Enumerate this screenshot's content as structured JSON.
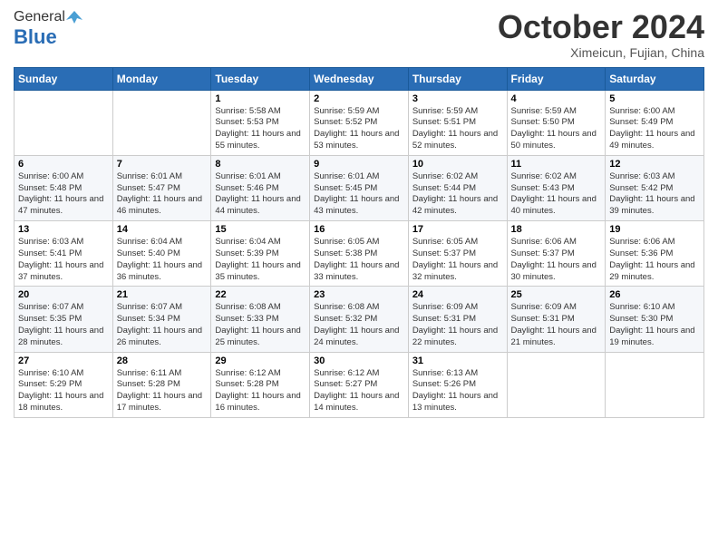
{
  "logo": {
    "general": "General",
    "blue": "Blue"
  },
  "header": {
    "month": "October 2024",
    "location": "Ximeicun, Fujian, China"
  },
  "days_of_week": [
    "Sunday",
    "Monday",
    "Tuesday",
    "Wednesday",
    "Thursday",
    "Friday",
    "Saturday"
  ],
  "weeks": [
    [
      {
        "day": "",
        "sunrise": "",
        "sunset": "",
        "daylight": ""
      },
      {
        "day": "",
        "sunrise": "",
        "sunset": "",
        "daylight": ""
      },
      {
        "day": "1",
        "sunrise": "Sunrise: 5:58 AM",
        "sunset": "Sunset: 5:53 PM",
        "daylight": "Daylight: 11 hours and 55 minutes."
      },
      {
        "day": "2",
        "sunrise": "Sunrise: 5:59 AM",
        "sunset": "Sunset: 5:52 PM",
        "daylight": "Daylight: 11 hours and 53 minutes."
      },
      {
        "day": "3",
        "sunrise": "Sunrise: 5:59 AM",
        "sunset": "Sunset: 5:51 PM",
        "daylight": "Daylight: 11 hours and 52 minutes."
      },
      {
        "day": "4",
        "sunrise": "Sunrise: 5:59 AM",
        "sunset": "Sunset: 5:50 PM",
        "daylight": "Daylight: 11 hours and 50 minutes."
      },
      {
        "day": "5",
        "sunrise": "Sunrise: 6:00 AM",
        "sunset": "Sunset: 5:49 PM",
        "daylight": "Daylight: 11 hours and 49 minutes."
      }
    ],
    [
      {
        "day": "6",
        "sunrise": "Sunrise: 6:00 AM",
        "sunset": "Sunset: 5:48 PM",
        "daylight": "Daylight: 11 hours and 47 minutes."
      },
      {
        "day": "7",
        "sunrise": "Sunrise: 6:01 AM",
        "sunset": "Sunset: 5:47 PM",
        "daylight": "Daylight: 11 hours and 46 minutes."
      },
      {
        "day": "8",
        "sunrise": "Sunrise: 6:01 AM",
        "sunset": "Sunset: 5:46 PM",
        "daylight": "Daylight: 11 hours and 44 minutes."
      },
      {
        "day": "9",
        "sunrise": "Sunrise: 6:01 AM",
        "sunset": "Sunset: 5:45 PM",
        "daylight": "Daylight: 11 hours and 43 minutes."
      },
      {
        "day": "10",
        "sunrise": "Sunrise: 6:02 AM",
        "sunset": "Sunset: 5:44 PM",
        "daylight": "Daylight: 11 hours and 42 minutes."
      },
      {
        "day": "11",
        "sunrise": "Sunrise: 6:02 AM",
        "sunset": "Sunset: 5:43 PM",
        "daylight": "Daylight: 11 hours and 40 minutes."
      },
      {
        "day": "12",
        "sunrise": "Sunrise: 6:03 AM",
        "sunset": "Sunset: 5:42 PM",
        "daylight": "Daylight: 11 hours and 39 minutes."
      }
    ],
    [
      {
        "day": "13",
        "sunrise": "Sunrise: 6:03 AM",
        "sunset": "Sunset: 5:41 PM",
        "daylight": "Daylight: 11 hours and 37 minutes."
      },
      {
        "day": "14",
        "sunrise": "Sunrise: 6:04 AM",
        "sunset": "Sunset: 5:40 PM",
        "daylight": "Daylight: 11 hours and 36 minutes."
      },
      {
        "day": "15",
        "sunrise": "Sunrise: 6:04 AM",
        "sunset": "Sunset: 5:39 PM",
        "daylight": "Daylight: 11 hours and 35 minutes."
      },
      {
        "day": "16",
        "sunrise": "Sunrise: 6:05 AM",
        "sunset": "Sunset: 5:38 PM",
        "daylight": "Daylight: 11 hours and 33 minutes."
      },
      {
        "day": "17",
        "sunrise": "Sunrise: 6:05 AM",
        "sunset": "Sunset: 5:37 PM",
        "daylight": "Daylight: 11 hours and 32 minutes."
      },
      {
        "day": "18",
        "sunrise": "Sunrise: 6:06 AM",
        "sunset": "Sunset: 5:37 PM",
        "daylight": "Daylight: 11 hours and 30 minutes."
      },
      {
        "day": "19",
        "sunrise": "Sunrise: 6:06 AM",
        "sunset": "Sunset: 5:36 PM",
        "daylight": "Daylight: 11 hours and 29 minutes."
      }
    ],
    [
      {
        "day": "20",
        "sunrise": "Sunrise: 6:07 AM",
        "sunset": "Sunset: 5:35 PM",
        "daylight": "Daylight: 11 hours and 28 minutes."
      },
      {
        "day": "21",
        "sunrise": "Sunrise: 6:07 AM",
        "sunset": "Sunset: 5:34 PM",
        "daylight": "Daylight: 11 hours and 26 minutes."
      },
      {
        "day": "22",
        "sunrise": "Sunrise: 6:08 AM",
        "sunset": "Sunset: 5:33 PM",
        "daylight": "Daylight: 11 hours and 25 minutes."
      },
      {
        "day": "23",
        "sunrise": "Sunrise: 6:08 AM",
        "sunset": "Sunset: 5:32 PM",
        "daylight": "Daylight: 11 hours and 24 minutes."
      },
      {
        "day": "24",
        "sunrise": "Sunrise: 6:09 AM",
        "sunset": "Sunset: 5:31 PM",
        "daylight": "Daylight: 11 hours and 22 minutes."
      },
      {
        "day": "25",
        "sunrise": "Sunrise: 6:09 AM",
        "sunset": "Sunset: 5:31 PM",
        "daylight": "Daylight: 11 hours and 21 minutes."
      },
      {
        "day": "26",
        "sunrise": "Sunrise: 6:10 AM",
        "sunset": "Sunset: 5:30 PM",
        "daylight": "Daylight: 11 hours and 19 minutes."
      }
    ],
    [
      {
        "day": "27",
        "sunrise": "Sunrise: 6:10 AM",
        "sunset": "Sunset: 5:29 PM",
        "daylight": "Daylight: 11 hours and 18 minutes."
      },
      {
        "day": "28",
        "sunrise": "Sunrise: 6:11 AM",
        "sunset": "Sunset: 5:28 PM",
        "daylight": "Daylight: 11 hours and 17 minutes."
      },
      {
        "day": "29",
        "sunrise": "Sunrise: 6:12 AM",
        "sunset": "Sunset: 5:28 PM",
        "daylight": "Daylight: 11 hours and 16 minutes."
      },
      {
        "day": "30",
        "sunrise": "Sunrise: 6:12 AM",
        "sunset": "Sunset: 5:27 PM",
        "daylight": "Daylight: 11 hours and 14 minutes."
      },
      {
        "day": "31",
        "sunrise": "Sunrise: 6:13 AM",
        "sunset": "Sunset: 5:26 PM",
        "daylight": "Daylight: 11 hours and 13 minutes."
      },
      {
        "day": "",
        "sunrise": "",
        "sunset": "",
        "daylight": ""
      },
      {
        "day": "",
        "sunrise": "",
        "sunset": "",
        "daylight": ""
      }
    ]
  ]
}
